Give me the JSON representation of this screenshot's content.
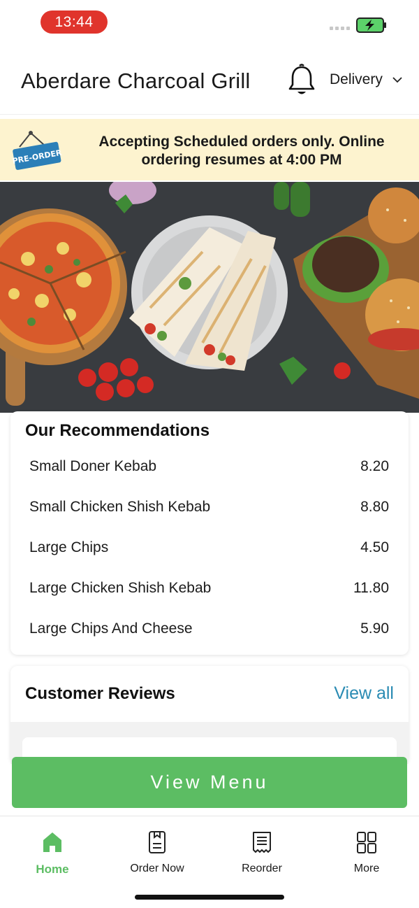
{
  "status_bar": {
    "time": "13:44"
  },
  "header": {
    "restaurant_name": "Aberdare Charcoal Grill",
    "delivery_label": "Delivery"
  },
  "banner": {
    "sign_text": "PRE-ORDER",
    "message": "Accepting Scheduled orders only. Online ordering resumes at 4:00 PM"
  },
  "recommendations": {
    "title": "Our Recommendations",
    "items": [
      {
        "name": "Small Doner Kebab",
        "price": "8.20"
      },
      {
        "name": "Small Chicken Shish Kebab",
        "price": "8.80"
      },
      {
        "name": "Large Chips",
        "price": "4.50"
      },
      {
        "name": "Large Chicken Shish Kebab",
        "price": "11.80"
      },
      {
        "name": "Large Chips And Cheese",
        "price": "5.90"
      }
    ]
  },
  "reviews": {
    "title": "Customer Reviews",
    "view_all": "View all"
  },
  "view_menu_label": "View Menu",
  "bottom_nav": {
    "items": [
      {
        "label": "Home",
        "icon": "home-icon",
        "active": true
      },
      {
        "label": "Order Now",
        "icon": "order-icon",
        "active": false
      },
      {
        "label": "Reorder",
        "icon": "receipt-icon",
        "active": false
      },
      {
        "label": "More",
        "icon": "grid-icon",
        "active": false
      }
    ]
  },
  "colors": {
    "accent_green": "#5cbd63",
    "link_blue": "#2a8bb3",
    "time_pill_red": "#e0342c",
    "banner_bg": "#fdf3cf",
    "preorder_sign_blue": "#2b7fb8"
  }
}
